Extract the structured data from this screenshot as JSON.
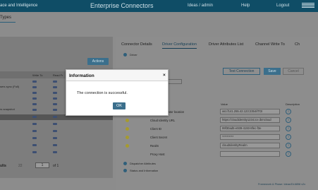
{
  "header": {
    "app_name": "ace and Intelligence",
    "title": "Enterprise Connectors",
    "user": "Ideas / admin",
    "help": "Help",
    "logout": "Logout",
    "logo": "IBM"
  },
  "page": {
    "types_tab": "Types"
  },
  "left_panel": {
    "actions_label": "Actions",
    "column_write_to": "Write To",
    "column_read_from": "Read Fr",
    "rows": [
      {
        "label": ""
      },
      {
        "label": "sers sync (Full)"
      },
      {
        "label": ""
      },
      {
        "label": ""
      },
      {
        "label": ""
      },
      {
        "label": "rs snapshot"
      },
      {
        "label": ""
      },
      {
        "label": ""
      },
      {
        "label": ""
      },
      {
        "label": ""
      },
      {
        "label": ""
      },
      {
        "label": ""
      }
    ],
    "pager": {
      "label": "ults",
      "count": "22",
      "page": "1",
      "of": "of 1"
    }
  },
  "right_panel": {
    "tabs": [
      {
        "label": "Connector Details"
      },
      {
        "label": "Driver Configuration"
      },
      {
        "label": "Driver Attributes List"
      },
      {
        "label": "Channel Write To"
      },
      {
        "label": "Ch"
      }
    ],
    "driver_section": "Driver",
    "select_value": "Select",
    "buttons": {
      "test": "Test Connection",
      "save": "Save",
      "cancel": "Cancel"
    },
    "grid_headers": {
      "value": "Value",
      "description": "Description"
    },
    "properties": [
      {
        "name": "Identity Integrator location",
        "value": "ws://141.255.42.123:2354/ITDI"
      },
      {
        "name": "Cloud Identity URL",
        "value": "https://cloudidentity1234.ice.ibmcloud"
      },
      {
        "name": "Client ID",
        "value": "99f30ad5-e939-4193-8fec-f3e"
      },
      {
        "name": "Client Secret",
        "value": "**********"
      },
      {
        "name": "Realm",
        "value": "cloudIdentityRealm"
      },
      {
        "name": "Proxy Host",
        "value": ""
      }
    ],
    "dispatcher_section": "Dispatcher Attributes",
    "status_section": "Status and Information",
    "footer": "Framework & Phase: Ideas/DL6898 v2x"
  },
  "modal": {
    "title": "Information",
    "close": "×",
    "message": "The connection is successful.",
    "ok_label": "OK"
  }
}
